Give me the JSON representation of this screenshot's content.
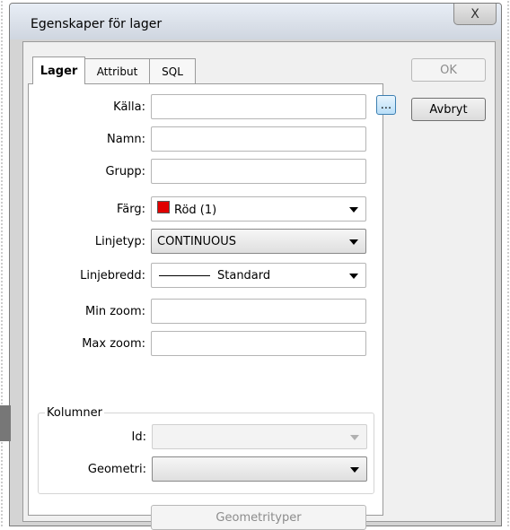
{
  "window": {
    "title": "Egenskaper för lager",
    "close_glyph": "X"
  },
  "tabs": [
    {
      "label": "Lager",
      "active": true
    },
    {
      "label": "Attribut",
      "active": false
    },
    {
      "label": "SQL",
      "active": false
    }
  ],
  "form": {
    "kalla": {
      "label": "Källa:",
      "value": "",
      "browse_label": "..."
    },
    "namn": {
      "label": "Namn:",
      "value": ""
    },
    "grupp": {
      "label": "Grupp:",
      "value": ""
    },
    "farg": {
      "label": "Färg:",
      "value": "Röd (1)",
      "swatch_color": "#e00000"
    },
    "linjetyp": {
      "label": "Linjetyp:",
      "value": "CONTINUOUS"
    },
    "linjebredd": {
      "label": "Linjebredd:",
      "value": "Standard"
    },
    "min_zoom": {
      "label": "Min zoom:",
      "value": ""
    },
    "max_zoom": {
      "label": "Max zoom:",
      "value": ""
    }
  },
  "kolumner": {
    "title": "Kolumner",
    "id": {
      "label": "Id:",
      "value": ""
    },
    "geometri": {
      "label": "Geometri:",
      "value": ""
    }
  },
  "buttons": {
    "geometrityper": "Geometrityper",
    "ok": "OK",
    "avbryt": "Avbryt"
  },
  "icons": [
    "close-icon",
    "dropdown-arrow-icon",
    "color-swatch-icon",
    "line-sample-icon"
  ]
}
